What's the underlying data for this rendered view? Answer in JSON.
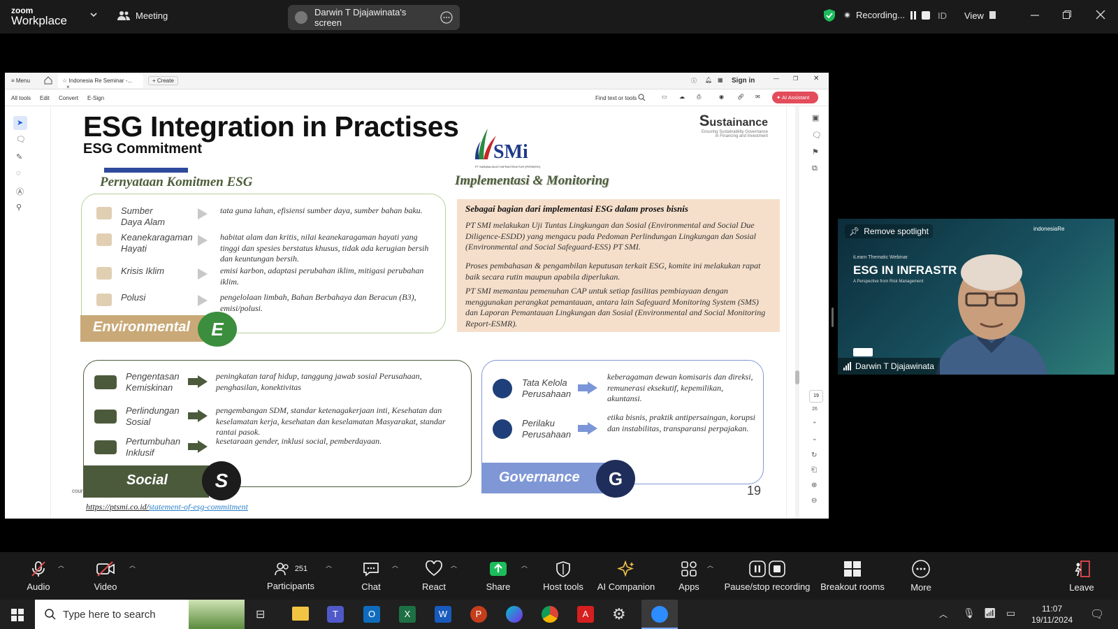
{
  "zoom": {
    "brand_small": "zoom",
    "brand_large": "Workplace",
    "meeting_label": "Meeting",
    "screen_share_label": "Darwin T Djajawinata's screen",
    "recording_label": "Recording...",
    "id_label": "ID",
    "view_label": "View"
  },
  "pdf": {
    "menu": "Menu",
    "tab_title": "Indonesia Re Seminar -...",
    "create": "Create",
    "sign_in": "Sign in",
    "tools": [
      "All tools",
      "Edit",
      "Convert",
      "E-Sign"
    ],
    "find": "Find text or tools",
    "ai_assistant": "AI Assistant",
    "page_num": "19",
    "page_total": "26"
  },
  "slide": {
    "title": "ESG Integration in Practises",
    "subtitle": "ESG Commitment",
    "brand_s": "S",
    "brand_rest": "ustainance",
    "brand_tag1": "Ensuring Sustainability Governance",
    "brand_tag2": "in Financing and Investment",
    "logo_text": "SMi",
    "logo_caption": "PT SARANA MULTI INFRASTRUKTUR (PERSERO)",
    "left_heading": "Pernyataan Komitmen ESG",
    "right_heading": "Implementasi & Monitoring",
    "env_items": [
      {
        "label": "Sumber\nDaya Alam",
        "desc": "tata guna lahan, efisiensi sumber daya, sumber bahan baku."
      },
      {
        "label": "Keanekaragaman\nHayati",
        "desc": "habitat alam dan kritis, nilai keanekaragaman hayati yang tinggi dan spesies berstatus khusus, tidak ada kerugian bersih dan keuntungan bersih."
      },
      {
        "label": "Krisis Iklim",
        "desc": "emisi karbon, adaptasi perubahan iklim, mitigasi perubahan iklim."
      },
      {
        "label": "Polusi",
        "desc": "pengelolaan limbah, Bahan Berbahaya dan Beracun (B3), emisi/polusi."
      }
    ],
    "env_label": "Environmental",
    "env_letter": "E",
    "impl_heading": "Sebagai bagian dari implementasi ESG dalam proses bisnis",
    "impl_paras": [
      "PT SMI melakukan Uji Tuntas Lingkungan dan Sosial (Environmental and Social Due Diligence-ESDD) yang mengacu pada Pedoman Perlindungan Lingkungan dan Sosial (Environmental and Social Safeguard-ESS) PT SMI.",
      "Proses pembahasan & pengambilan keputusan terkait ESG, komite ini melakukan rapat baik secara rutin maupun apabila diperlukan.",
      "PT SMI memantau pemenuhan CAP untuk setiap fasilitas pembiayaan dengan menggunakan perangkat pemantauan, antara lain Safeguard Monitoring System (SMS) dan Laporan Pemantauan Lingkungan dan Sosial (Environmental and Social Monitoring Report-ESMR)."
    ],
    "soc_items": [
      {
        "label": "Pengentasan\nKemiskinan",
        "desc": "peningkatan taraf hidup, tanggung jawab sosial Perusahaan, penghasilan, konektivitas"
      },
      {
        "label": "Perlindungan\nSosial",
        "desc": "pengembangan SDM, standar ketenagakerjaan inti, Kesehatan dan keselamatan kerja, kesehatan dan keselamatan Masyarakat, standar rantai pasok."
      },
      {
        "label": "Pertumbuhan\nInklusif",
        "desc": "kesetaraan gender, inklusi social, pemberdayaan."
      }
    ],
    "soc_label": "Social",
    "soc_letter": "S",
    "gov_items": [
      {
        "label": "Tata Kelola\nPerusahaan",
        "desc": "keberagaman dewan komisaris dan direksi, remunerasi eksekutif, kepemilikan, akuntansi."
      },
      {
        "label": "Perilaku\nPerusahaan",
        "desc": "etika bisnis, praktik antipersaingan, korupsi dan instabilitas, transparansi perpajakan."
      }
    ],
    "gov_label": "Governance",
    "gov_letter": "G",
    "page_number": "19",
    "source_prefix": "cour",
    "url_base": "https://ptsmi.co.id/",
    "url_path": "statement-of-esg-commitment"
  },
  "video": {
    "remove_spotlight": "Remove spotlight",
    "top_logo": "indonesiaRe",
    "thematic": "iLearn Thematic Webinar",
    "big_title": "ESG IN INFRASTR",
    "sub_title": "A Perspective from Risk Management",
    "name": "Darwin T Djajawinata"
  },
  "toolbar": {
    "audio": "Audio",
    "video": "Video",
    "participants": "Participants",
    "participants_count": "251",
    "chat": "Chat",
    "react": "React",
    "share": "Share",
    "host_tools": "Host tools",
    "ai_companion": "AI Companion",
    "apps": "Apps",
    "pause_recording": "Pause/stop recording",
    "breakout": "Breakout rooms",
    "more": "More",
    "leave": "Leave"
  },
  "taskbar": {
    "search_placeholder": "Type here to search",
    "time": "11:07",
    "date": "19/11/2024"
  },
  "colors": {
    "zoom_bg": "#1a1a1a",
    "share_green": "#1dbc5c",
    "env_green": "#b5d29a",
    "env_tan": "#c9a978",
    "soc_dark": "#4c5a3c",
    "gov_blue": "#8097d6",
    "gov_navy": "#1f2d5a",
    "impl_bg": "#f5dfcb",
    "ai_red": "#e34c5a"
  }
}
